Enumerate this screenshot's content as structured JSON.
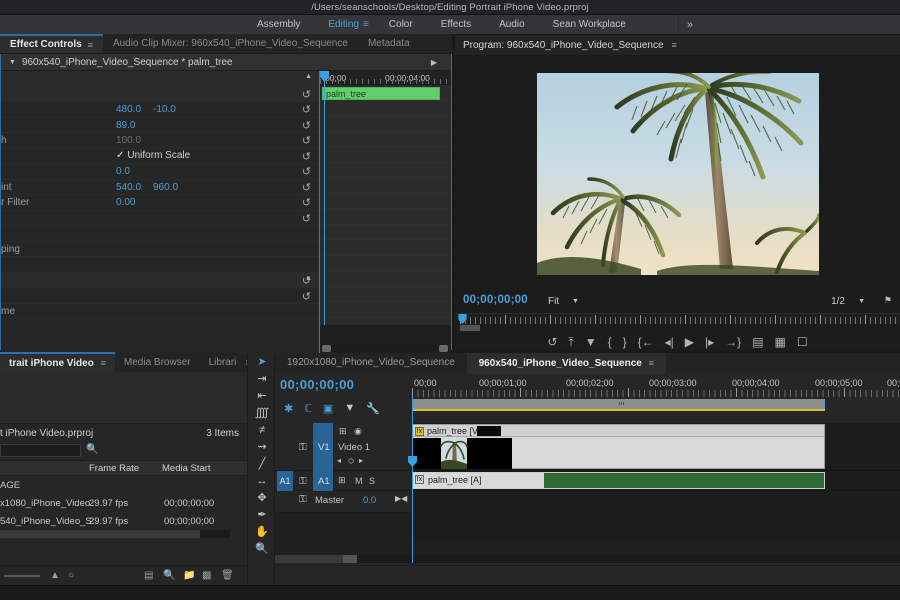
{
  "window": {
    "title": "/Users/seanschools/Desktop/Editing Portrait iPhone Video.prproj"
  },
  "workspace": {
    "items": [
      "Assembly",
      "Editing",
      "Color",
      "Effects",
      "Audio",
      "Sean Workplace"
    ],
    "active": "Editing",
    "more_label": "»",
    "burger": "≡"
  },
  "effect_controls": {
    "tabs": [
      {
        "label": "Effect Controls",
        "active": true,
        "burger": "≡"
      },
      {
        "label": "Audio Clip Mixer: 960x540_iPhone_Video_Sequence",
        "active": false
      },
      {
        "label": "Metadata",
        "active": false
      }
    ],
    "header": {
      "arrow": "▼",
      "title": "960x540_iPhone_Video_Sequence * palm_tree",
      "play_arrow": "▶"
    },
    "rows": [
      {
        "label": "",
        "values": [],
        "reset": false,
        "collapse": "▲",
        "shaded": true
      },
      {
        "label": "",
        "values": [],
        "reset": true,
        "shaded": true
      },
      {
        "label": "",
        "values": [
          "480.0",
          "-10.0"
        ],
        "reset": true
      },
      {
        "label": "",
        "values": [
          "89.0"
        ],
        "reset": true
      },
      {
        "label": "h",
        "values": [
          "100.0"
        ],
        "dim": true,
        "reset": true
      },
      {
        "label": "",
        "check": "Uniform Scale",
        "tick": "✓",
        "reset": true
      },
      {
        "label": "",
        "values": [
          "0.0"
        ],
        "reset": true
      },
      {
        "label": "int",
        "values": [
          "540.0",
          "960.0"
        ],
        "reset": true
      },
      {
        "label": "r Filter",
        "values": [
          "0.00"
        ],
        "reset": true
      },
      {
        "label": "",
        "values": [],
        "reset": true
      },
      {
        "label": "",
        "values": []
      },
      {
        "label": "ping",
        "values": []
      },
      {
        "label": "",
        "values": [],
        "collapse": "▲",
        "shaded": true
      },
      {
        "label": "",
        "values": [],
        "reset": true
      },
      {
        "label": "me",
        "values": [],
        "reset": true
      }
    ],
    "reset_icon": "↺",
    "timeline": {
      "start_label": "00;00",
      "end_label": "00;00;04;00",
      "clip_label": "palm_tree"
    },
    "footer_icons": [
      "keyframe-audio-icon",
      "export-frame-icon"
    ]
  },
  "program_monitor": {
    "title": "Program: 960x540_iPhone_Video_Sequence",
    "burger": "≡",
    "timecode": "00;00;00;00",
    "fit_label": "Fit",
    "fit_arrow": "▼",
    "resolution_label": "1/2",
    "resolution_arrow": "▼",
    "wrench": "⚑",
    "buttons": [
      "↶",
      "⤴",
      "▼",
      "{",
      "}",
      "{←",
      "◂|",
      "▶",
      "|▸",
      "→}",
      "⚐",
      "⚑",
      "□"
    ],
    "camera_button": "▣"
  },
  "project": {
    "tabs": [
      {
        "label": "trait iPhone Video",
        "active": true,
        "burger": "≡"
      },
      {
        "label": "Media Browser",
        "active": false
      },
      {
        "label": "Librari",
        "active": false
      }
    ],
    "more": "»",
    "file_name": "t iPhone Video.prproj",
    "item_count": "3 Items",
    "search_placeholder": "",
    "find_icon": "🔍",
    "columns": [
      "Frame Rate",
      "Media Start"
    ],
    "rows": [
      {
        "name": "AGE",
        "frame_rate": "",
        "media_start": ""
      },
      {
        "name": "x1080_iPhone_Video",
        "frame_rate": "29.97 fps",
        "media_start": "00;00;00;00"
      },
      {
        "name": "540_iPhone_Video_S",
        "frame_rate": "29.97 fps",
        "media_start": "00;00;00;00"
      }
    ],
    "bottom_icons": [
      "list-view-icon",
      "search-icon",
      "new-bin-icon",
      "new-item-icon",
      "trash-icon"
    ],
    "zoom_icons": [
      "automate-icon",
      "refresh-icon"
    ]
  },
  "tools": [
    {
      "name": "selection-tool",
      "glyph": "➤",
      "active": true
    },
    {
      "name": "track-select-forward-tool",
      "glyph": "⇥"
    },
    {
      "name": "track-select-backward-tool",
      "glyph": "⇤"
    },
    {
      "name": "ripple-edit-tool",
      "glyph": "⬌"
    },
    {
      "name": "rolling-edit-tool",
      "glyph": "⫤"
    },
    {
      "name": "rate-stretch-tool",
      "glyph": "⇹"
    },
    {
      "name": "razor-tool",
      "glyph": "╱"
    },
    {
      "name": "slip-tool",
      "glyph": "↔"
    },
    {
      "name": "slide-tool",
      "glyph": "✥"
    },
    {
      "name": "pen-tool",
      "glyph": "✒"
    },
    {
      "name": "hand-tool",
      "glyph": "✋"
    },
    {
      "name": "zoom-tool",
      "glyph": "🔍"
    }
  ],
  "timeline": {
    "tabs": [
      {
        "label": "1920x1080_iPhone_Video_Sequence",
        "active": false
      },
      {
        "label": "960x540_iPhone_Video_Sequence",
        "active": true,
        "close": "×",
        "burger": "≡"
      }
    ],
    "timecode": "00;00;00;00",
    "ruler_labels": [
      "00;00",
      "00;00;01;00",
      "00;00;02;00",
      "00;00;03;00",
      "00;00;04;00",
      "00;00;05;00",
      "00;0"
    ],
    "tool_icons": [
      "snap-icon",
      "linked-selection-icon",
      "add-marker-icon",
      "marker-icon",
      "settings-icon"
    ],
    "video_track": {
      "lock": "⚿",
      "name": "V1",
      "label": "Video 1",
      "sync_icon": "⊞",
      "eye_icon": "◉",
      "keyframe_prev": "◂",
      "keyframe_dot": "◇",
      "keyframe_next": "▸",
      "clip_name": "palm_tree [V]",
      "fx_badge": "fx"
    },
    "audio_track": {
      "target": "A1",
      "lock": "⚿",
      "name": "A1",
      "sync_icon": "⊞",
      "mute": "M",
      "solo": "S",
      "clip_name": "palm_tree [A]",
      "fx_badge": "fx"
    },
    "master_track": {
      "lock": "⚿",
      "label": "Master",
      "value": "0.0",
      "meter_icon": "▶◀"
    }
  },
  "colors": {
    "accent_blue": "#4a9fd8",
    "panel_bg": "#262626",
    "tab_bg": "#232323",
    "clip_video": "#d8d8d8",
    "clip_audio": "#2d6b33",
    "clip_green": "#63cd6a",
    "render_bar": "#d3c324",
    "selection_blue": "#2a6496"
  }
}
